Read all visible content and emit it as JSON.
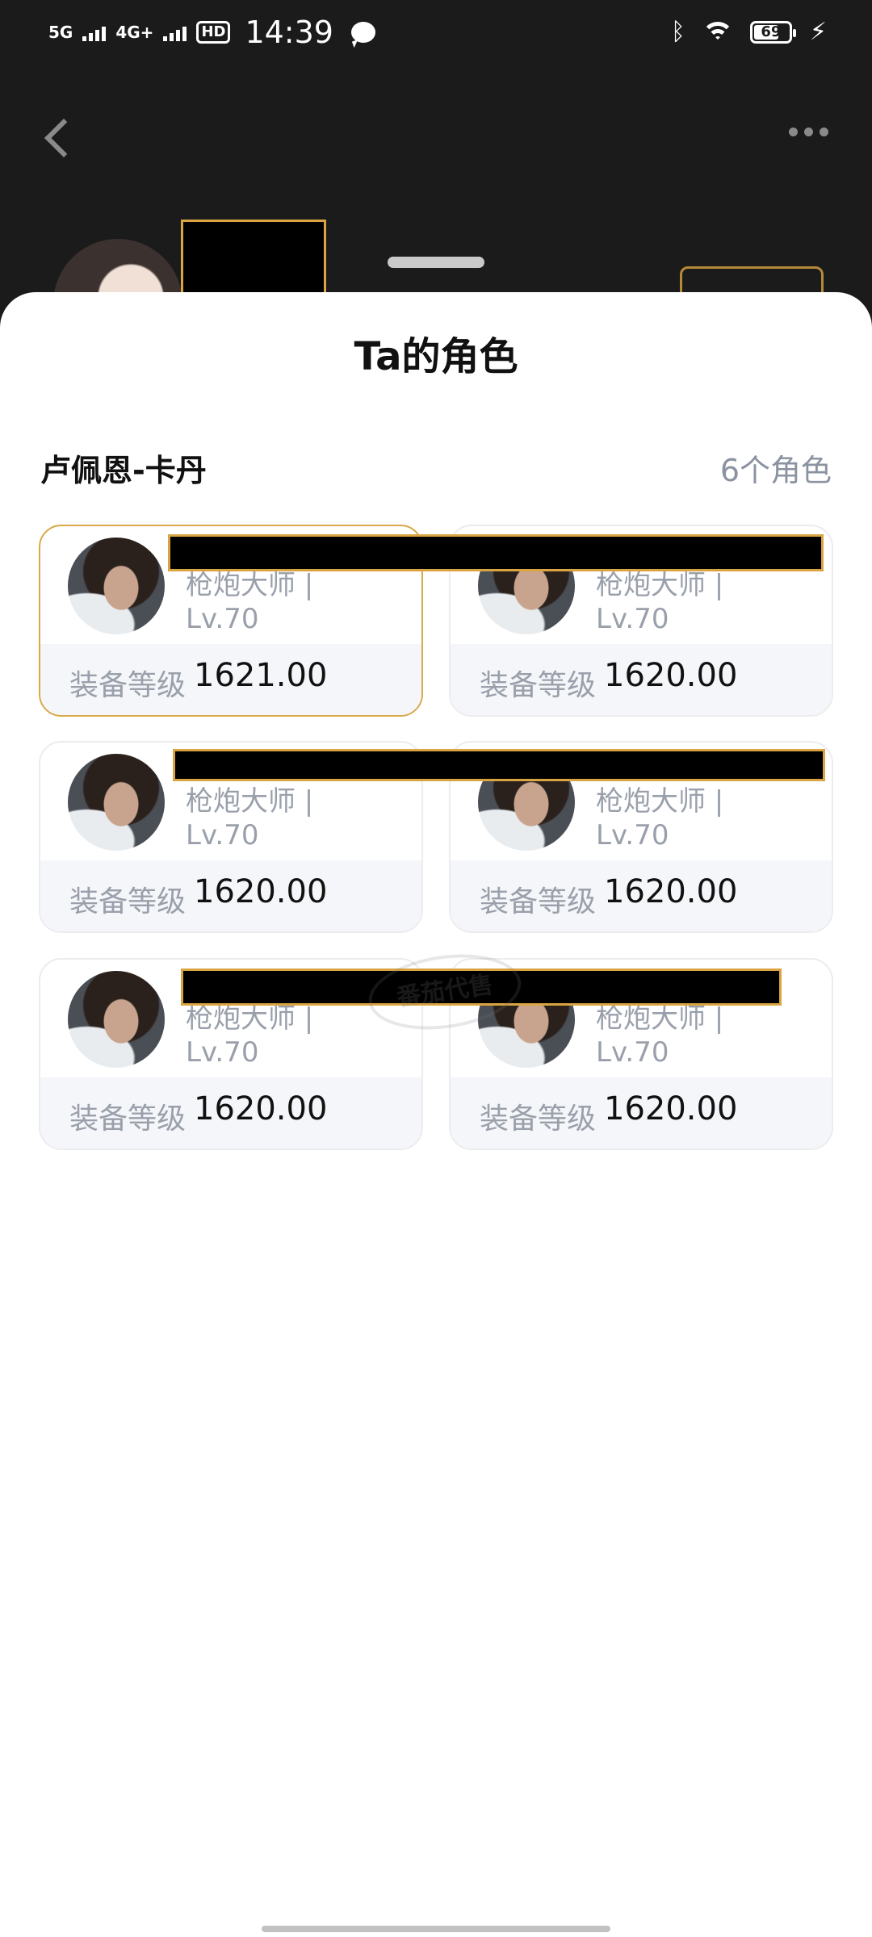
{
  "status_bar": {
    "net1": "5G",
    "net2": "4G+",
    "hd": "HD",
    "time": "14:39",
    "battery": "69",
    "icons": [
      "signal-icon",
      "message-bubble-icon",
      "bluetooth-icon",
      "wifi-icon",
      "battery-icon",
      "charging-icon"
    ]
  },
  "sheet": {
    "title": "Ta的角色",
    "server_name": "卢佩恩-卡丹",
    "char_count": "6个角色"
  },
  "characters": [
    {
      "class_level": "枪炮大师 | Lv.70",
      "equip_label": "装备等级",
      "equip_value": "1621.00",
      "selected": true
    },
    {
      "class_level": "枪炮大师 | Lv.70",
      "equip_label": "装备等级",
      "equip_value": "1620.00",
      "selected": false
    },
    {
      "class_level": "枪炮大师 | Lv.70",
      "equip_label": "装备等级",
      "equip_value": "1620.00",
      "selected": false
    },
    {
      "class_level": "枪炮大师 | Lv.70",
      "equip_label": "装备等级",
      "equip_value": "1620.00",
      "selected": false
    },
    {
      "class_level": "枪炮大师 | Lv.70",
      "equip_label": "装备等级",
      "equip_value": "1620.00",
      "selected": false
    },
    {
      "class_level": "枪炮大师 | Lv.70",
      "equip_label": "装备等级",
      "equip_value": "1620.00",
      "selected": false
    }
  ],
  "watermark": "番茄代售",
  "colors": {
    "accent": "#d8a84a",
    "muted_text": "#9aa0ab",
    "card_footer_bg": "#f5f6f9",
    "redaction": "#000000"
  }
}
